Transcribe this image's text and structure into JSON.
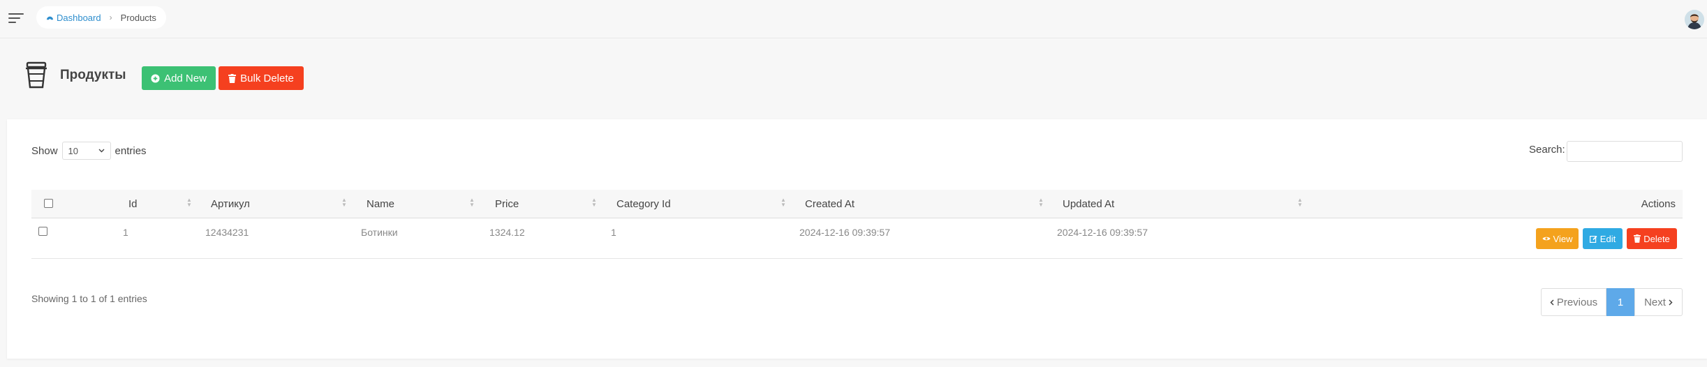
{
  "breadcrumb": {
    "home": "Dashboard",
    "current": "Products"
  },
  "page": {
    "title": "Продукты"
  },
  "toolbar": {
    "add_label": "Add New",
    "bulk_delete_label": "Bulk Delete"
  },
  "table_controls": {
    "show_label": "Show",
    "entries_label": "entries",
    "page_length": "10",
    "search_label": "Search:",
    "search_value": ""
  },
  "table": {
    "columns": [
      "Id",
      "Артикул",
      "Name",
      "Price",
      "Category Id",
      "Created At",
      "Updated At",
      "Actions"
    ],
    "rows": [
      {
        "id": "1",
        "sku": "12434231",
        "name": "Ботинки",
        "price": "1324.12",
        "category_id": "1",
        "created_at": "2024-12-16 09:39:57",
        "updated_at": "2024-12-16 09:39:57"
      }
    ],
    "row_actions": {
      "view": "View",
      "edit": "Edit",
      "delete": "Delete"
    }
  },
  "footer": {
    "info": "Showing 1 to 1 of 1 entries",
    "pagination": {
      "previous": "Previous",
      "current_page": "1",
      "next": "Next"
    }
  },
  "colors": {
    "link": "#2e8ece",
    "add": "#3cc174",
    "danger": "#f5401f",
    "view": "#f4a21d",
    "edit": "#2faae3",
    "page_active": "#5ea9e9"
  },
  "icons": [
    "menu-icon",
    "dashboard-icon",
    "chevron-right-icon",
    "avatar",
    "cup-icon",
    "plus-circle-icon",
    "trash-icon",
    "eye-icon",
    "edit-icon",
    "chevron-left-icon",
    "chevron-down-icon",
    "sort-icon"
  ]
}
